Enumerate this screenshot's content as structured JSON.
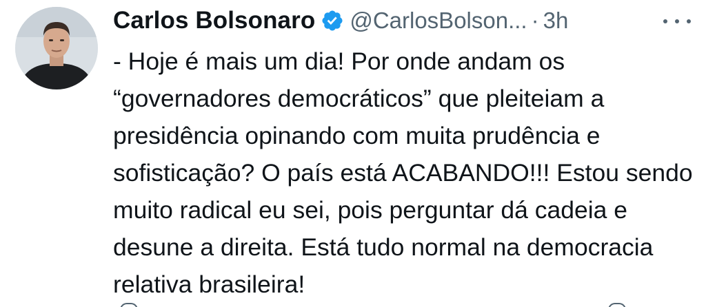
{
  "tweet": {
    "author": {
      "name": "Carlos Bolsonaro",
      "handle": "@CarlosBolson...",
      "verified": true
    },
    "separator": "·",
    "time": "3h",
    "text": "- Hoje é mais um dia! Por onde andam os “governadores democráticos” que pleiteiam a presidência opinando com muita prudência e sofisticação? O país está ACABANDO!!! Estou sendo muito radical eu sei, pois perguntar dá cadeia e desune a direita. Está tudo normal na democracia relativa brasileira!"
  },
  "icons": {
    "verified": "verified-badge-icon",
    "more": "more-options-icon",
    "reply": "reply-icon",
    "share": "share-icon"
  },
  "colors": {
    "text": "#0f1419",
    "secondary": "#536471",
    "verified_blue": "#1d9bf0",
    "background": "#ffffff"
  }
}
